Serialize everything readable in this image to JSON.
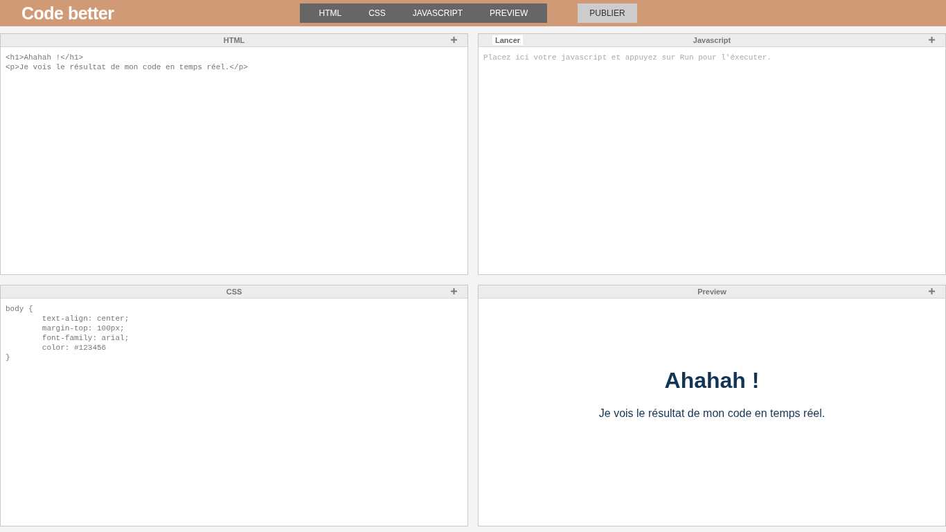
{
  "header": {
    "logo": "Code better",
    "nav": [
      "HTML",
      "CSS",
      "JAVASCRIPT",
      "PREVIEW"
    ],
    "publish": "PUBLIER"
  },
  "panels": [
    {
      "kind": "code",
      "title": "HTML",
      "lines": [
        "<h1>Ahahah !</h1>",
        "<p>Je vois le résultat de mon code en temps réel.</p>"
      ]
    },
    {
      "kind": "code",
      "title": "Javascript",
      "run_button": "Lancer",
      "placeholder": "Placez ici votre javascript et appuyez sur Run pour l'éxecuter."
    },
    {
      "kind": "code",
      "title": "CSS",
      "lines": [
        "body {",
        "        text-align: center;",
        "        margin-top: 100px;",
        "        font-family: arial;",
        "        color: #123456",
        "}"
      ]
    },
    {
      "kind": "preview",
      "title": "Preview",
      "heading": "Ahahah !",
      "paragraph": "Je vois le résultat de mon code en temps réel."
    }
  ]
}
